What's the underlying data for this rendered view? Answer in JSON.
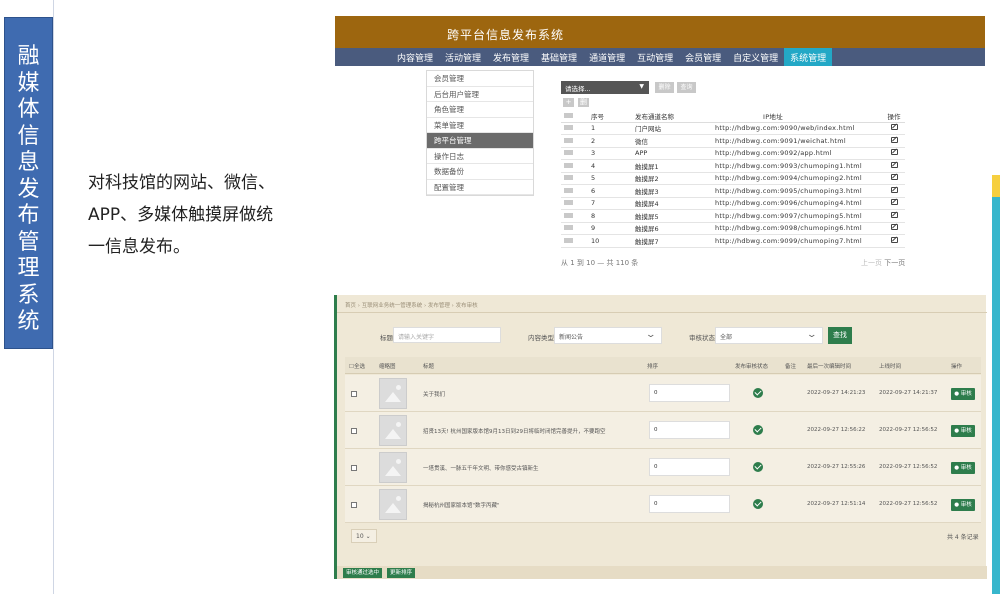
{
  "slide": {
    "title_chars": [
      "融",
      "媒",
      "体",
      "信",
      "息",
      "发",
      "布",
      "管",
      "理",
      "系",
      "统"
    ],
    "description": [
      "对科技馆的网站、微信、",
      "APP、多媒体触摸屏做统",
      "一信息发布。"
    ]
  },
  "admin": {
    "banner_title": "跨平台信息发布系统",
    "nav": [
      "内容管理",
      "活动管理",
      "发布管理",
      "基础管理",
      "通道管理",
      "互动管理",
      "会员管理",
      "自定义管理",
      "系统管理"
    ],
    "nav_active": "系统管理",
    "sidebar": [
      "会员管理",
      "后台用户管理",
      "角色管理",
      "菜单管理",
      "跨平台管理",
      "操作日志",
      "数据备份",
      "配置管理"
    ],
    "sidebar_active": "跨平台管理",
    "select_placeholder": "请选择...",
    "buttons": {
      "btn_a": "删除",
      "btn_b": "查询",
      "add": "+",
      "delete": "删"
    },
    "columns": [
      "序号",
      "发布通道名称",
      "IP地址",
      "操作"
    ],
    "rows": [
      {
        "no": "1",
        "name": "门户网站",
        "ip": "http://hdbwg.com:9090/web/index.html"
      },
      {
        "no": "2",
        "name": "微信",
        "ip": "http://hdbwg.com:9091/weichat.html"
      },
      {
        "no": "3",
        "name": "APP",
        "ip": "http://hdbwg.com:9092/app.html"
      },
      {
        "no": "4",
        "name": "触摸屏1",
        "ip": "http://hdbwg.com:9093/chumoping1.html"
      },
      {
        "no": "5",
        "name": "触摸屏2",
        "ip": "http://hdbwg.com:9094/chumoping2.html"
      },
      {
        "no": "6",
        "name": "触摸屏3",
        "ip": "http://hdbwg.com:9095/chumoping3.html"
      },
      {
        "no": "7",
        "name": "触摸屏4",
        "ip": "http://hdbwg.com:9096/chumoping4.html"
      },
      {
        "no": "8",
        "name": "触摸屏5",
        "ip": "http://hdbwg.com:9097/chumoping5.html"
      },
      {
        "no": "9",
        "name": "触摸屏6",
        "ip": "http://hdbwg.com:9098/chumoping6.html"
      },
      {
        "no": "10",
        "name": "触摸屏7",
        "ip": "http://hdbwg.com:9099/chumoping7.html"
      }
    ],
    "footer": "从 1 到 10 — 共 110 条",
    "pager_prev": "上一页",
    "pager_next": "下一页"
  },
  "review": {
    "breadcrumb": "首页 › 互联网业务统一管理系统 › 发布管理 › 发布审核",
    "title_label": "标题",
    "title_placeholder": "请输入关键字",
    "type_label": "内容类型",
    "type_value": "新闻公告",
    "status_label": "审核状态",
    "status_value": "全部",
    "search_button": "查找",
    "headers": {
      "select_all": "全选",
      "thumb": "缩略图",
      "title": "标题",
      "order": "排序",
      "status": "发布审核状态",
      "note": "备注",
      "edit_time": "最后一次编辑时间",
      "online_time": "上线时间",
      "action": "操作"
    },
    "rows": [
      {
        "title": "关于我们",
        "order": "0",
        "edit_time": "2022-09-27 14:21:23",
        "online_time": "2022-09-27 14:21:37",
        "action": "审核"
      },
      {
        "title": "招贤13天! 杭州国家版本馆9月13日到29日将临时闭馆完善提升，不要跑空",
        "order": "0",
        "edit_time": "2022-09-27 12:56:22",
        "online_time": "2022-09-27 12:56:52",
        "action": "审核"
      },
      {
        "title": "一塔贯溪、一脉五千年文明、带你感受古镇新生",
        "order": "0",
        "edit_time": "2022-09-27 12:55:26",
        "online_time": "2022-09-27 12:56:52",
        "action": "审核"
      },
      {
        "title": "揭秘杭州国家版本馆\"数字丙藏\"",
        "order": "0",
        "edit_time": "2022-09-27 12:51:14",
        "online_time": "2022-09-27 12:56:52",
        "action": "审核"
      }
    ],
    "page_size": "10",
    "total": "共 4 条记录",
    "bottom_buttons": [
      "审核通过选中",
      "更新排序"
    ],
    "accent_color": "#2e7d4c"
  }
}
